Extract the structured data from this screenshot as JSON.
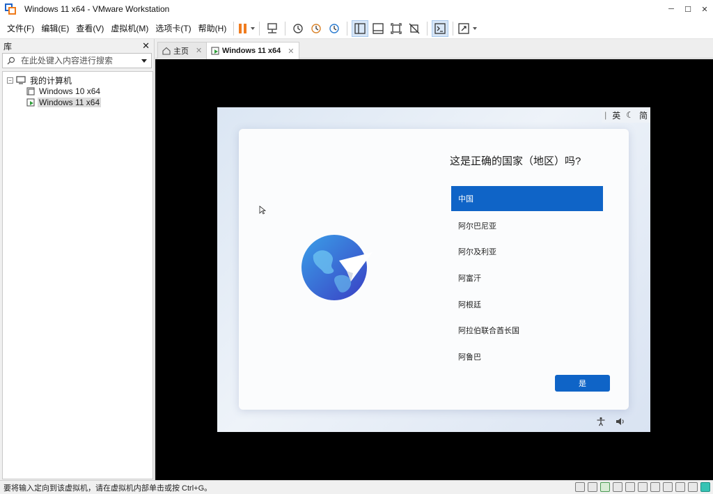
{
  "window": {
    "title": "Windows 11 x64 - VMware Workstation"
  },
  "menu": [
    {
      "label": "文件(F)"
    },
    {
      "label": "编辑(E)"
    },
    {
      "label": "查看(V)"
    },
    {
      "label": "虚拟机(M)"
    },
    {
      "label": "选项卡(T)"
    },
    {
      "label": "帮助(H)"
    }
  ],
  "library": {
    "title": "库",
    "search_placeholder": "在此处键入内容进行搜索",
    "root": "我的计算机",
    "items": [
      {
        "label": "Windows 10 x64"
      },
      {
        "label": "Windows 11 x64",
        "selected": true
      }
    ]
  },
  "tabs": [
    {
      "label": "主页"
    },
    {
      "label": "Windows 11 x64",
      "active": true
    }
  ],
  "guest": {
    "ime": {
      "mode": "英",
      "moon": "☾",
      "lang": "简"
    },
    "oobe": {
      "title": "这是正确的国家（地区）吗?",
      "countries": [
        {
          "label": "中国",
          "selected": true
        },
        {
          "label": "阿尔巴尼亚"
        },
        {
          "label": "阿尔及利亚"
        },
        {
          "label": "阿富汗"
        },
        {
          "label": "阿根廷"
        },
        {
          "label": "阿拉伯联合酋长国"
        },
        {
          "label": "阿鲁巴"
        }
      ],
      "yes_button": "是"
    }
  },
  "statusbar": {
    "text": "要将输入定向到该虚拟机，请在虚拟机内部单击或按 Ctrl+G。"
  },
  "colors": {
    "accent": "#0f64c7",
    "pause": "#f07c1e"
  }
}
